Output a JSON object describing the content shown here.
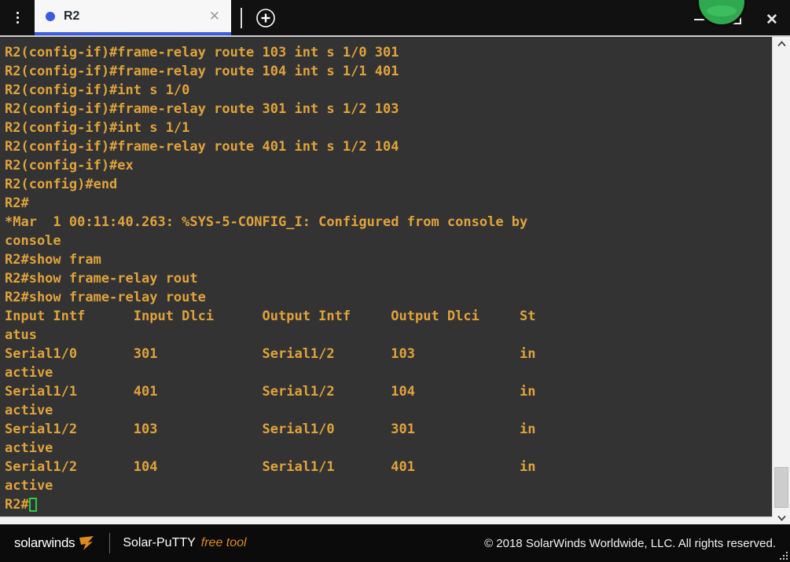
{
  "window": {
    "menu_icon": "kebab-menu-icon",
    "minimize_label": "–",
    "maximize_label": "□",
    "close_label": "✕",
    "brand_orb": "solarwinds-orb-logo"
  },
  "tabs": {
    "new_tab_label": "+",
    "items": [
      {
        "label": "R2",
        "status_dot_color": "#3b5be0",
        "close_label": "✕",
        "active": true
      }
    ]
  },
  "terminal": {
    "background": "#333333",
    "foreground": "#e0a33c",
    "cursor_color": "#2ecc40",
    "lines": [
      "R2(config-if)#frame-relay route 103 int s 1/0 301",
      "R2(config-if)#frame-relay route 104 int s 1/1 401",
      "R2(config-if)#int s 1/0",
      "R2(config-if)#frame-relay route 301 int s 1/2 103",
      "R2(config-if)#int s 1/1",
      "R2(config-if)#frame-relay route 401 int s 1/2 104",
      "R2(config-if)#ex",
      "R2(config)#end",
      "R2#",
      "*Mar  1 00:11:40.263: %SYS-5-CONFIG_I: Configured from console by",
      "console",
      "R2#show fram",
      "R2#show frame-relay rout",
      "R2#show frame-relay route",
      "Input Intf      Input Dlci      Output Intf     Output Dlci     St",
      "atus",
      "Serial1/0       301             Serial1/2       103             in",
      "active",
      "Serial1/1       401             Serial1/2       104             in",
      "active",
      "Serial1/2       103             Serial1/0       301             in",
      "active",
      "Serial1/2       104             Serial1/1       401             in",
      "active"
    ],
    "prompt_line": "R2#",
    "frame_relay_route_table": {
      "columns": [
        "Input Intf",
        "Input Dlci",
        "Output Intf",
        "Output Dlci",
        "Status"
      ],
      "rows": [
        [
          "Serial1/0",
          "301",
          "Serial1/2",
          "103",
          "inactive"
        ],
        [
          "Serial1/1",
          "401",
          "Serial1/2",
          "104",
          "inactive"
        ],
        [
          "Serial1/2",
          "103",
          "Serial1/0",
          "301",
          "inactive"
        ],
        [
          "Serial1/2",
          "104",
          "Serial1/1",
          "401",
          "inactive"
        ]
      ]
    },
    "scrollbar": {
      "up_arrow": "chevron-up-icon",
      "down_arrow": "chevron-down-icon"
    }
  },
  "footer": {
    "logo_text": "solarwinds",
    "product_name": "Solar-PuTTY",
    "product_tag": "free tool",
    "copyright": "© 2018 SolarWinds Worldwide, LLC. All rights reserved.",
    "accent_color": "#e08a1e"
  }
}
